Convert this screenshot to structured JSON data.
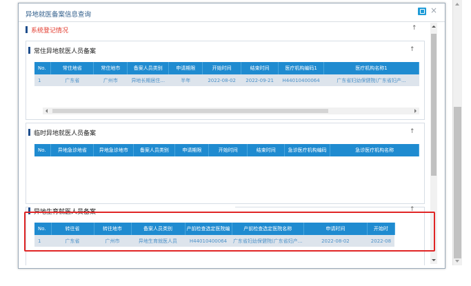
{
  "dialog": {
    "title": "异地就医备案信息查询",
    "close_glyph": "×"
  },
  "registration": {
    "title": "系统登记情况",
    "collapse_glyph": "↑"
  },
  "permanent": {
    "title": "常住异地就医人员备案",
    "collapse_glyph": "↑",
    "columns": [
      "No.",
      "常住地省",
      "常住地市",
      "备案人员类别",
      "申请期限",
      "开始时间",
      "结束时间",
      "医疗机构编码1",
      "医疗机构名称1"
    ],
    "rows": [
      [
        "1",
        "广东省",
        "广州市",
        "异地长期居住...",
        "半年",
        "2022-08-02",
        "2022-09-21",
        "H44010400064",
        "广东省妇幼保健院(广东省妇产..."
      ]
    ]
  },
  "temporary": {
    "title": "临时异地就医人员备案",
    "collapse_glyph": "↑",
    "columns": [
      "No.",
      "异地急诊地省",
      "异地急诊地市",
      "备案人员类别",
      "申请期限",
      "开始时间",
      "结束时间",
      "急诊医疗机构编码",
      "急诊医疗机构名称"
    ],
    "rows": []
  },
  "maternity": {
    "title": "异地生育就医人员备案",
    "collapse_glyph": "↑",
    "columns": [
      "No.",
      "转往省",
      "转往地市",
      "备案人员类别",
      "产前检查选定医院编",
      "产前检查选定医院名称",
      "申请时间",
      "开始时"
    ],
    "rows": [
      [
        "1",
        "广东省",
        "广州市",
        "异地生育就医人员",
        "H44010400064",
        "广东省妇幼保健院(广东省妇产...",
        "2022-08-02",
        "2022-08"
      ]
    ]
  },
  "colors": {
    "header_blue": "#1f8bd0",
    "row_bg": "#dde4ec",
    "cell_text": "#4a90c8",
    "highlight": "#e02424",
    "section_bar": "#1f4e8c",
    "red_title": "#e23b2e"
  }
}
